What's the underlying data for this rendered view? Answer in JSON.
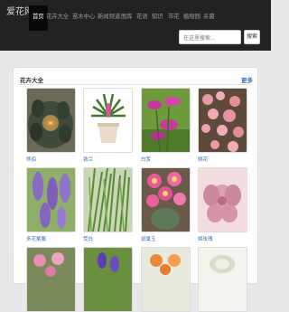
{
  "site": {
    "brand": "爱花网",
    "nav": [
      "首页",
      "花卉大全",
      "苗木中心",
      "新闻频道",
      "图库",
      "花语",
      "知识",
      "市花",
      "植物园",
      "杀菌"
    ],
    "active_nav": "首页",
    "search": {
      "placeholder": "在这里搜索...",
      "button": "搜索"
    }
  },
  "panel": {
    "title": "花卉大全",
    "more": "更多",
    "items": [
      {
        "name": "熊佰"
      },
      {
        "name": "铁兰"
      },
      {
        "name": "白笈"
      },
      {
        "name": "桃花"
      },
      {
        "name": "多花紫藤"
      },
      {
        "name": "茭白"
      },
      {
        "name": "鼠巢玉"
      },
      {
        "name": "姬玫瑰"
      }
    ]
  },
  "colors": {
    "navbar": "#222222",
    "link": "#3b6fb6",
    "page_bg": "#e8e8e8"
  }
}
